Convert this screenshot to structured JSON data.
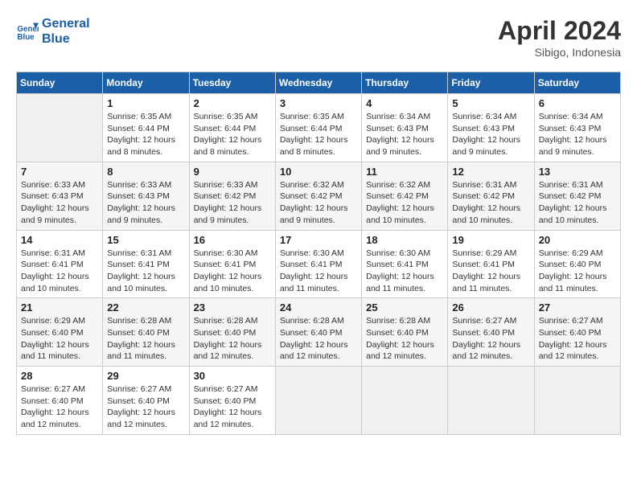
{
  "header": {
    "logo_line1": "General",
    "logo_line2": "Blue",
    "month": "April 2024",
    "location": "Sibigo, Indonesia"
  },
  "days_of_week": [
    "Sunday",
    "Monday",
    "Tuesday",
    "Wednesday",
    "Thursday",
    "Friday",
    "Saturday"
  ],
  "weeks": [
    [
      {
        "day": "",
        "empty": true
      },
      {
        "day": "1",
        "sunrise": "Sunrise: 6:35 AM",
        "sunset": "Sunset: 6:44 PM",
        "daylight": "Daylight: 12 hours and 8 minutes."
      },
      {
        "day": "2",
        "sunrise": "Sunrise: 6:35 AM",
        "sunset": "Sunset: 6:44 PM",
        "daylight": "Daylight: 12 hours and 8 minutes."
      },
      {
        "day": "3",
        "sunrise": "Sunrise: 6:35 AM",
        "sunset": "Sunset: 6:44 PM",
        "daylight": "Daylight: 12 hours and 8 minutes."
      },
      {
        "day": "4",
        "sunrise": "Sunrise: 6:34 AM",
        "sunset": "Sunset: 6:43 PM",
        "daylight": "Daylight: 12 hours and 9 minutes."
      },
      {
        "day": "5",
        "sunrise": "Sunrise: 6:34 AM",
        "sunset": "Sunset: 6:43 PM",
        "daylight": "Daylight: 12 hours and 9 minutes."
      },
      {
        "day": "6",
        "sunrise": "Sunrise: 6:34 AM",
        "sunset": "Sunset: 6:43 PM",
        "daylight": "Daylight: 12 hours and 9 minutes."
      }
    ],
    [
      {
        "day": "7",
        "sunrise": "Sunrise: 6:33 AM",
        "sunset": "Sunset: 6:43 PM",
        "daylight": "Daylight: 12 hours and 9 minutes."
      },
      {
        "day": "8",
        "sunrise": "Sunrise: 6:33 AM",
        "sunset": "Sunset: 6:43 PM",
        "daylight": "Daylight: 12 hours and 9 minutes."
      },
      {
        "day": "9",
        "sunrise": "Sunrise: 6:33 AM",
        "sunset": "Sunset: 6:42 PM",
        "daylight": "Daylight: 12 hours and 9 minutes."
      },
      {
        "day": "10",
        "sunrise": "Sunrise: 6:32 AM",
        "sunset": "Sunset: 6:42 PM",
        "daylight": "Daylight: 12 hours and 9 minutes."
      },
      {
        "day": "11",
        "sunrise": "Sunrise: 6:32 AM",
        "sunset": "Sunset: 6:42 PM",
        "daylight": "Daylight: 12 hours and 10 minutes."
      },
      {
        "day": "12",
        "sunrise": "Sunrise: 6:31 AM",
        "sunset": "Sunset: 6:42 PM",
        "daylight": "Daylight: 12 hours and 10 minutes."
      },
      {
        "day": "13",
        "sunrise": "Sunrise: 6:31 AM",
        "sunset": "Sunset: 6:42 PM",
        "daylight": "Daylight: 12 hours and 10 minutes."
      }
    ],
    [
      {
        "day": "14",
        "sunrise": "Sunrise: 6:31 AM",
        "sunset": "Sunset: 6:41 PM",
        "daylight": "Daylight: 12 hours and 10 minutes."
      },
      {
        "day": "15",
        "sunrise": "Sunrise: 6:31 AM",
        "sunset": "Sunset: 6:41 PM",
        "daylight": "Daylight: 12 hours and 10 minutes."
      },
      {
        "day": "16",
        "sunrise": "Sunrise: 6:30 AM",
        "sunset": "Sunset: 6:41 PM",
        "daylight": "Daylight: 12 hours and 10 minutes."
      },
      {
        "day": "17",
        "sunrise": "Sunrise: 6:30 AM",
        "sunset": "Sunset: 6:41 PM",
        "daylight": "Daylight: 12 hours and 11 minutes."
      },
      {
        "day": "18",
        "sunrise": "Sunrise: 6:30 AM",
        "sunset": "Sunset: 6:41 PM",
        "daylight": "Daylight: 12 hours and 11 minutes."
      },
      {
        "day": "19",
        "sunrise": "Sunrise: 6:29 AM",
        "sunset": "Sunset: 6:41 PM",
        "daylight": "Daylight: 12 hours and 11 minutes."
      },
      {
        "day": "20",
        "sunrise": "Sunrise: 6:29 AM",
        "sunset": "Sunset: 6:40 PM",
        "daylight": "Daylight: 12 hours and 11 minutes."
      }
    ],
    [
      {
        "day": "21",
        "sunrise": "Sunrise: 6:29 AM",
        "sunset": "Sunset: 6:40 PM",
        "daylight": "Daylight: 12 hours and 11 minutes."
      },
      {
        "day": "22",
        "sunrise": "Sunrise: 6:28 AM",
        "sunset": "Sunset: 6:40 PM",
        "daylight": "Daylight: 12 hours and 11 minutes."
      },
      {
        "day": "23",
        "sunrise": "Sunrise: 6:28 AM",
        "sunset": "Sunset: 6:40 PM",
        "daylight": "Daylight: 12 hours and 12 minutes."
      },
      {
        "day": "24",
        "sunrise": "Sunrise: 6:28 AM",
        "sunset": "Sunset: 6:40 PM",
        "daylight": "Daylight: 12 hours and 12 minutes."
      },
      {
        "day": "25",
        "sunrise": "Sunrise: 6:28 AM",
        "sunset": "Sunset: 6:40 PM",
        "daylight": "Daylight: 12 hours and 12 minutes."
      },
      {
        "day": "26",
        "sunrise": "Sunrise: 6:27 AM",
        "sunset": "Sunset: 6:40 PM",
        "daylight": "Daylight: 12 hours and 12 minutes."
      },
      {
        "day": "27",
        "sunrise": "Sunrise: 6:27 AM",
        "sunset": "Sunset: 6:40 PM",
        "daylight": "Daylight: 12 hours and 12 minutes."
      }
    ],
    [
      {
        "day": "28",
        "sunrise": "Sunrise: 6:27 AM",
        "sunset": "Sunset: 6:40 PM",
        "daylight": "Daylight: 12 hours and 12 minutes."
      },
      {
        "day": "29",
        "sunrise": "Sunrise: 6:27 AM",
        "sunset": "Sunset: 6:40 PM",
        "daylight": "Daylight: 12 hours and 12 minutes."
      },
      {
        "day": "30",
        "sunrise": "Sunrise: 6:27 AM",
        "sunset": "Sunset: 6:40 PM",
        "daylight": "Daylight: 12 hours and 12 minutes."
      },
      {
        "day": "",
        "empty": true
      },
      {
        "day": "",
        "empty": true
      },
      {
        "day": "",
        "empty": true
      },
      {
        "day": "",
        "empty": true
      }
    ]
  ]
}
